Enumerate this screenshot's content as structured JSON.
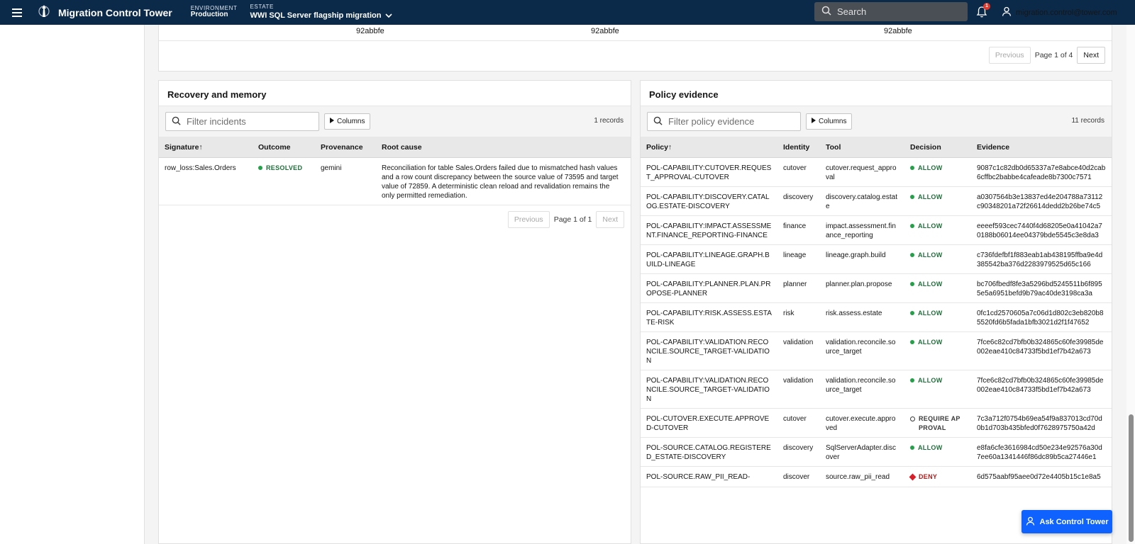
{
  "header": {
    "app_title": "Migration Control Tower",
    "environment_label": "ENVIRONMENT",
    "environment_value": "Production",
    "estate_label": "ESTATE",
    "estate_value": "WWI SQL Server flagship migration",
    "search_placeholder": "Search",
    "notification_count": "1",
    "user_email": "migration.control@tower.com"
  },
  "top_panel": {
    "hashes": [
      "92abbfe",
      "92abbfe",
      "92abbfe"
    ],
    "pager": {
      "previous": "Previous",
      "page": "Page 1 of 4",
      "next": "Next"
    }
  },
  "recovery": {
    "title": "Recovery and memory",
    "filter_placeholder": "Filter incidents",
    "columns_label": "Columns",
    "records": "1 records",
    "headers": [
      "Signature↑",
      "Outcome",
      "Provenance",
      "Root cause"
    ],
    "rows": [
      {
        "signature": "row_loss:Sales.Orders",
        "outcome": "RESOLVED",
        "provenance": "gemini",
        "root_cause": "Reconciliation for table Sales.Orders failed due to mismatched hash values and a row count discrepancy between the source value of 73595 and target value of 72859. A deterministic clean reload and revalidation remains the only permitted remediation."
      }
    ],
    "pager": {
      "previous": "Previous",
      "page": "Page 1 of 1",
      "next": "Next"
    }
  },
  "policy": {
    "title": "Policy evidence",
    "filter_placeholder": "Filter policy evidence",
    "columns_label": "Columns",
    "records": "11 records",
    "headers": [
      "Policy↑",
      "Identity",
      "Tool",
      "Decision",
      "Evidence"
    ],
    "rows": [
      {
        "policy": "POL-CAPABILITY:CUTOVER.REQUEST_APPROVAL-CUTOVER",
        "identity": "cutover",
        "tool": "cutover.request_approval",
        "decision": "ALLOW",
        "evidence": "9087c1c82db0d65337a7e8abce40d2cab6cffbc2babbe4cafeade8b7300c7571"
      },
      {
        "policy": "POL-CAPABILITY:DISCOVERY.CATALOG.ESTATE-DISCOVERY",
        "identity": "discovery",
        "tool": "discovery.catalog.estate",
        "decision": "ALLOW",
        "evidence": "a0307564b3e13837ed4e204788a73112c90348201a72f26614dedd2b26be74c5"
      },
      {
        "policy": "POL-CAPABILITY:IMPACT.ASSESSMENT.FINANCE_REPORTING-FINANCE",
        "identity": "finance",
        "tool": "impact.assessment.finance_reporting",
        "decision": "ALLOW",
        "evidence": "eeeef593cec7440f4d68205e0a41042a70188b06014ee04379bde5545c3e8da3"
      },
      {
        "policy": "POL-CAPABILITY:LINEAGE.GRAPH.BUILD-LINEAGE",
        "identity": "lineage",
        "tool": "lineage.graph.build",
        "decision": "ALLOW",
        "evidence": "c736fdefbf1f883eab1ab438195ffba9e4d385542ba376d2283979525d65c166"
      },
      {
        "policy": "POL-CAPABILITY:PLANNER.PLAN.PROPOSE-PLANNER",
        "identity": "planner",
        "tool": "planner.plan.propose",
        "decision": "ALLOW",
        "evidence": "bc706fbedf8fe3a5296bd5245511b6f8955e5a6951befd9b79ac40de3198ca3a"
      },
      {
        "policy": "POL-CAPABILITY:RISK.ASSESS.ESTATE-RISK",
        "identity": "risk",
        "tool": "risk.assess.estate",
        "decision": "ALLOW",
        "evidence": "0fc1cd2570605a7c06d1d802c3eb820b85520fd6b5fada1bfb3021d2f1f47652"
      },
      {
        "policy": "POL-CAPABILITY:VALIDATION.RECONCILE.SOURCE_TARGET-VALIDATION",
        "identity": "validation",
        "tool": "validation.reconcile.source_target",
        "decision": "ALLOW",
        "evidence": "7fce6c82cd7bfb0b324865c60fe39985de002eae410c84733f5bd1ef7b42a673"
      },
      {
        "policy": "POL-CAPABILITY:VALIDATION.RECONCILE.SOURCE_TARGET-VALIDATION",
        "identity": "validation",
        "tool": "validation.reconcile.source_target",
        "decision": "ALLOW",
        "evidence": "7fce6c82cd7bfb0b324865c60fe39985de002eae410c84733f5bd1ef7b42a673"
      },
      {
        "policy": "POL-CUTOVER.EXECUTE.APPROVED-CUTOVER",
        "identity": "cutover",
        "tool": "cutover.execute.approved",
        "decision": "REQUIRE APPROVAL",
        "evidence": "7c3a712f0754b69ea54f9a837013cd70d0b1d703b435bfed0f7628975750a42d"
      },
      {
        "policy": "POL-SOURCE.CATALOG.REGISTERED_ESTATE-DISCOVERY",
        "identity": "discovery",
        "tool": "SqlServerAdapter.discover",
        "decision": "ALLOW",
        "evidence": "e8fa6cfe3616984cd50e234e92576a30d7ee60a1341446f86dc89b5ca27446e1"
      },
      {
        "policy": "POL-SOURCE.RAW_PII_READ-",
        "identity": "discover",
        "tool": "source.raw_pii_read",
        "decision": "DENY",
        "evidence": "6d575aabf95aee0d72e4405b15c1e8a5"
      }
    ]
  },
  "assistant": {
    "label": "Ask Control Tower"
  },
  "colors": {
    "header_bg": "#0b2a4a",
    "allow": "#24a148",
    "deny": "#da1e28",
    "primary": "#0f62fe"
  }
}
